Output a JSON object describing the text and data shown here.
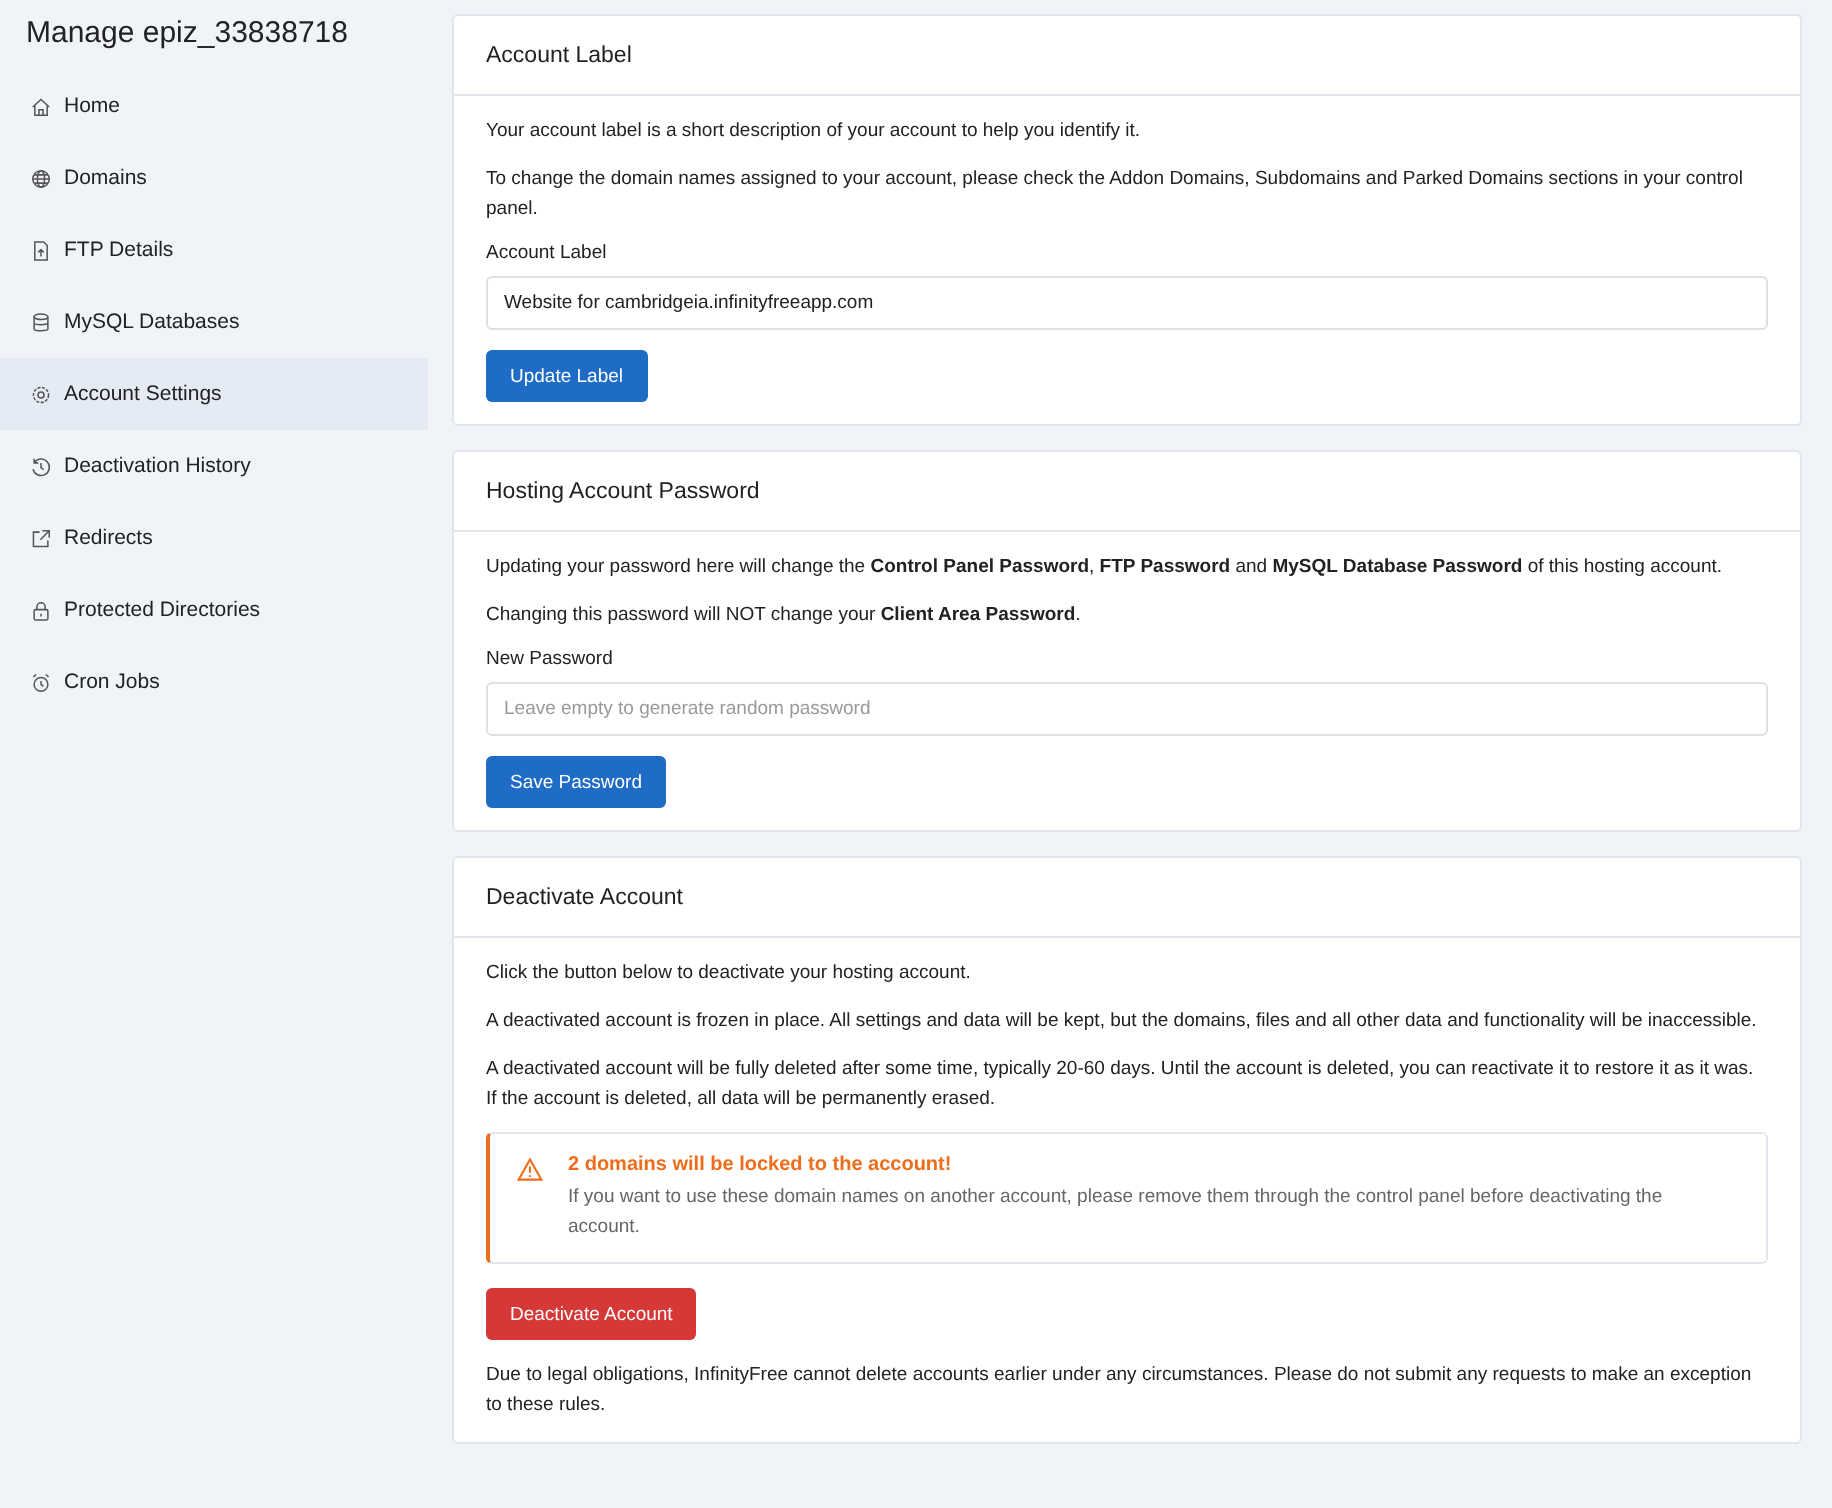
{
  "sidebar": {
    "title": "Manage epiz_33838718",
    "items": [
      {
        "label": "Home",
        "selected": false
      },
      {
        "label": "Domains",
        "selected": false
      },
      {
        "label": "FTP Details",
        "selected": false
      },
      {
        "label": "MySQL Databases",
        "selected": false
      },
      {
        "label": "Account Settings",
        "selected": true
      },
      {
        "label": "Deactivation History",
        "selected": false
      },
      {
        "label": "Redirects",
        "selected": false
      },
      {
        "label": "Protected Directories",
        "selected": false
      },
      {
        "label": "Cron Jobs",
        "selected": false
      }
    ]
  },
  "cards": [
    {
      "title": "Account Label",
      "blocks": [
        {
          "kind": "paragraph",
          "text": "Your account label is a short description of your account to help you identify it."
        },
        {
          "kind": "paragraph",
          "text": "To change the domain names assigned to your account, please check the Addon Domains, Subdomains and Parked Domains sections in your control panel."
        },
        {
          "kind": "field",
          "label": "Account Label",
          "value": "Website for cambridgeia.infinityfreeapp.com"
        },
        {
          "kind": "button",
          "label": "Update Label"
        }
      ]
    },
    {
      "title": "Hosting Account Password",
      "blocks": [
        {
          "kind": "paragraph",
          "text": "Updating your password here will change the **Control Panel Password**, **FTP Password** and **MySQL Database Password** of this hosting account."
        },
        {
          "kind": "paragraph",
          "text": "Changing this password will NOT change your **Client Area Password**."
        },
        {
          "kind": "field",
          "label": "New Password",
          "placeholder": "Leave empty to generate random password"
        },
        {
          "kind": "button",
          "label": "Save Password"
        }
      ]
    },
    {
      "title": "Deactivate Account",
      "blocks": [
        {
          "kind": "paragraph",
          "text": "Click the button below to deactivate your hosting account."
        },
        {
          "kind": "paragraph",
          "text": "A deactivated account is frozen in place. All settings and data will be kept, but the domains, files and all other data and functionality will be inaccessible."
        },
        {
          "kind": "paragraph",
          "text": "A deactivated account will be fully deleted after some time, typically 20-60 days. Until the account is deleted, you can reactivate it to restore it as it was. If the account is deleted, all data will be permanently erased."
        },
        {
          "kind": "alert",
          "title": "2 domains will be locked to the account!",
          "text": "If you want to use these domain names on another account, please remove them through the control panel before deactivating the account."
        },
        {
          "kind": "danger_button",
          "label": "Deactivate Account"
        },
        {
          "kind": "paragraph",
          "text": "Due to legal obligations, InfinityFree cannot delete accounts earlier under any circumstances. Please do not submit any requests to make an exception to these rules."
        }
      ]
    }
  ]
}
